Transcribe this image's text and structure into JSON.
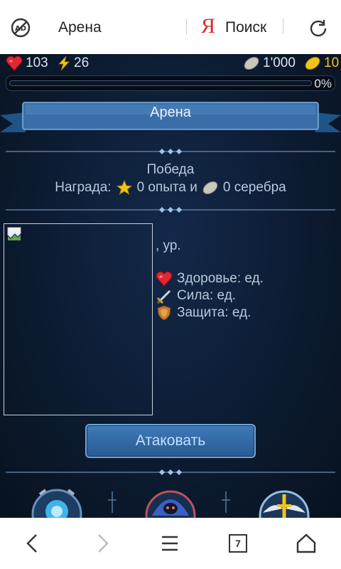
{
  "browser": {
    "page_title": "Арена",
    "search_label": "Поиск",
    "yandex_logo": "Я",
    "tab_count": "7",
    "icons": {
      "adblock": "ad-block-icon",
      "reload": "reload-icon",
      "back": "back-arrow-icon",
      "forward": "forward-arrow-icon",
      "menu": "menu-icon",
      "tabs": "tabs-icon",
      "home": "home-icon"
    }
  },
  "player": {
    "health": "103",
    "energy": "26",
    "silver": "1'000",
    "gold": "10",
    "xp_percent": "0%",
    "xp_fill": 0
  },
  "arena": {
    "title": "Арена",
    "result": "Победа",
    "reward_prefix": "Награда:",
    "reward_xp": "0 опыта и",
    "reward_silver": "0 серебра"
  },
  "opponent": {
    "level_text": ", ур.",
    "health": "Здоровье: ед.",
    "strength": "Сила: ед.",
    "defense": "Защита: ед."
  },
  "actions": {
    "attack": "Атаковать"
  },
  "colors": {
    "accent_gold": "#f2c418",
    "text": "#b7c9dc",
    "button": "#3f7ab8"
  }
}
